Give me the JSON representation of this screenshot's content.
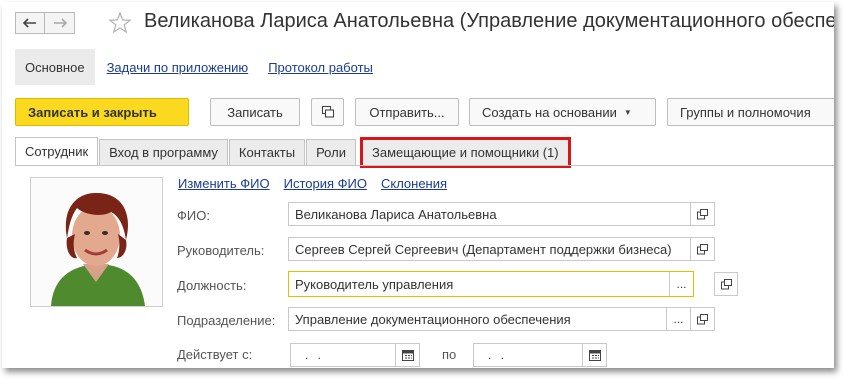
{
  "window": {
    "title": "Великанова Лариса Анатольевна (Управление документационного обеспечения)"
  },
  "sections": {
    "active": "Основное",
    "links": [
      "Задачи по приложению",
      "Протокол работы"
    ]
  },
  "toolbar": {
    "save_close": "Записать и закрыть",
    "save": "Записать",
    "send": "Отправить...",
    "create_based_on": "Создать на основании",
    "groups": "Группы и полномочия"
  },
  "tabs": [
    {
      "label": "Сотрудник",
      "active": true
    },
    {
      "label": "Вход в программу",
      "active": false
    },
    {
      "label": "Контакты",
      "active": false
    },
    {
      "label": "Роли",
      "active": false
    },
    {
      "label": "Замещающие и помощники (1)",
      "active": false,
      "highlighted": true
    }
  ],
  "form_links": [
    "Изменить ФИО",
    "История ФИО",
    "Склонения"
  ],
  "fields": {
    "fio": {
      "label": "ФИО:",
      "value": "Великанова Лариса Анатольевна"
    },
    "manager": {
      "label": "Руководитель:",
      "value": "Сергеев Сергей Сергеевич (Департамент поддержки бизнеса)"
    },
    "position": {
      "label": "Должность:",
      "value": "Руководитель управления"
    },
    "department": {
      "label": "Подразделение:",
      "value": "Управление документационного обеспечения"
    },
    "valid_from": {
      "label": "Действует с:",
      "value": " .  . "
    },
    "valid_to": {
      "label": "по",
      "value": " .  . "
    }
  },
  "colors": {
    "primary_button": "#fbd91e",
    "link": "#1b3c92",
    "highlight_border": "#d8161a",
    "focus_border": "#f0b900"
  },
  "icons": {
    "back": "arrow-left-icon",
    "forward": "arrow-right-icon",
    "favorite": "star-outline-icon",
    "copy": "copy-icon",
    "open": "open-window-icon",
    "select": "ellipsis-icon",
    "calendar": "calendar-icon"
  }
}
